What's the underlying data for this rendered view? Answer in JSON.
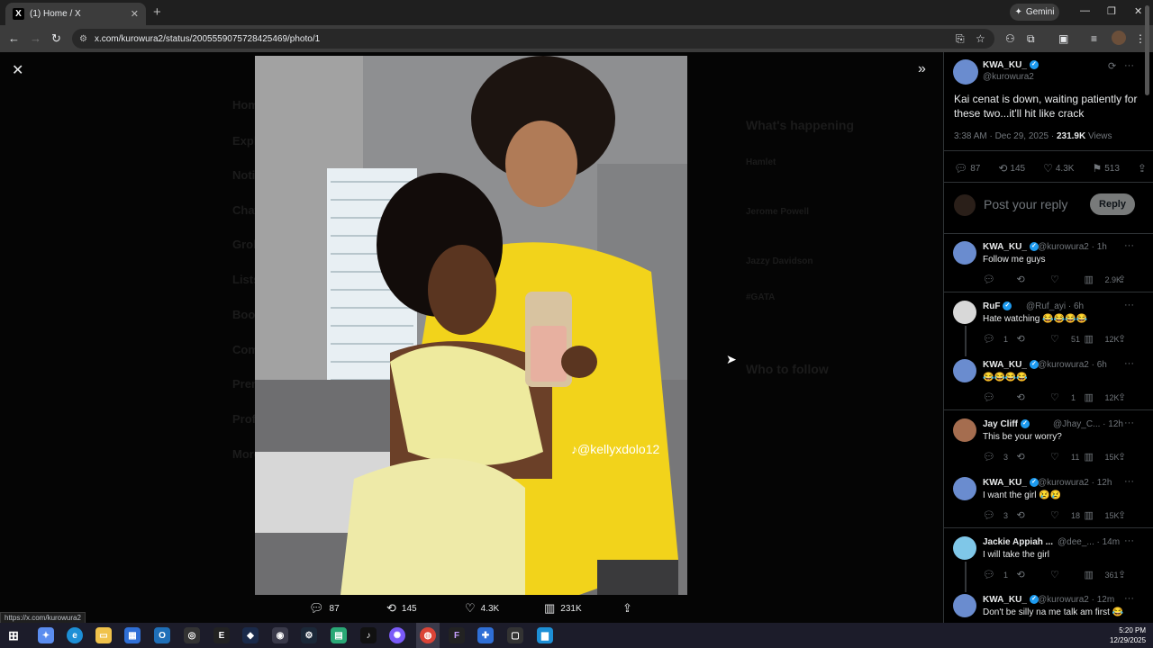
{
  "browser": {
    "tab_title": "(1) Home / X",
    "gemini_label": "Gemini",
    "url": "x.com/kurowura2/status/2005559075728425469/photo/1",
    "status_url": "https://x.com/kurowura2"
  },
  "photo": {
    "watermark": "@kellyxdolo12",
    "actions": {
      "replies": "87",
      "reposts": "145",
      "likes": "4.3K",
      "views": "231K"
    }
  },
  "background_nav": {
    "items": [
      "Home",
      "Explore",
      "Notifications",
      "Chat",
      "Grok",
      "Lists",
      "Bookmarks",
      "Communities",
      "Premium",
      "Profile",
      "More"
    ],
    "right_titles": [
      "What's happening",
      "Who to follow"
    ],
    "trends": [
      "Hamlet",
      "Jerome Powell",
      "Jazzy Davidson",
      "#GATA"
    ]
  },
  "post": {
    "author_name": "KWA_KU_",
    "author_handle": "@kurowura2",
    "text": "Kai cenat is down, waiting patiently for these two...it'll hit like crack",
    "time": "3:38 AM · Dec 29, 2025 · ",
    "views_count": "231.9K",
    "views_label": " Views",
    "stats": {
      "replies": "87",
      "reposts": "145",
      "likes": "4.3K",
      "bookmarks": "513"
    },
    "reply_placeholder": "Post your reply",
    "reply_button": "Reply"
  },
  "comments": [
    {
      "name": "KWA_KU_",
      "handle": "@kurowura2 · 1h",
      "text": "Follow me guys",
      "replies": "",
      "reposts": "",
      "likes": "",
      "views": "2.9K"
    },
    {
      "name": "RuF",
      "handle": "@Ruf_ayi · 6h",
      "text": "Hate watching 😂😂😂😂",
      "replies": "1",
      "reposts": "",
      "likes": "51",
      "views": "12K"
    },
    {
      "name": "KWA_KU_",
      "handle": "@kurowura2 · 6h",
      "text": "😂😂😂😂",
      "replies": "",
      "reposts": "",
      "likes": "1",
      "views": "12K"
    },
    {
      "name": "Jay Cliff",
      "handle": "@Jhay_C... · 12h",
      "text": "This be your worry?",
      "replies": "3",
      "reposts": "",
      "likes": "11",
      "views": "15K"
    },
    {
      "name": "KWA_KU_",
      "handle": "@kurowura2 · 12h",
      "text": "I want the girl 😢😢",
      "replies": "3",
      "reposts": "",
      "likes": "18",
      "views": "15K"
    },
    {
      "name": "Jackie Appiah ...",
      "handle": "@dee_... · 14m",
      "text": "I will take the girl",
      "replies": "1",
      "reposts": "",
      "likes": "",
      "views": "361"
    },
    {
      "name": "KWA_KU_",
      "handle": "@kurowura2 · 12m",
      "text": "Don't be silly na me talk am first 😂",
      "replies": "",
      "reposts": "",
      "likes": "",
      "views": ""
    }
  ],
  "taskbar": {
    "time": "5:20 PM",
    "date": "12/29/2025"
  }
}
